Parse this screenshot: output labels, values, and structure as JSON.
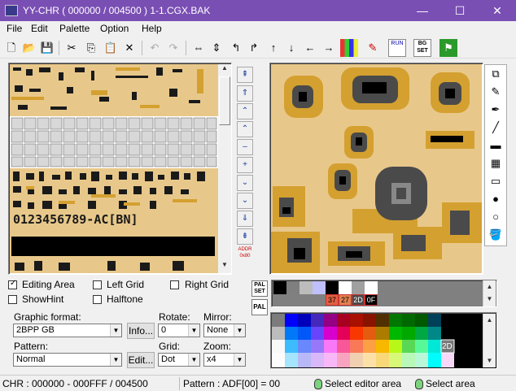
{
  "window": {
    "title": "YY-CHR ( 000000 / 004500 ) 1-1.CGX.BAK",
    "minimize": "—",
    "maximize": "☐",
    "close": "✕"
  },
  "menu": [
    "File",
    "Edit",
    "Palette",
    "Option",
    "Help"
  ],
  "toolbar": {
    "icons": [
      "new-file-icon",
      "open-folder-icon",
      "save-icon",
      "cut-icon",
      "copy-icon",
      "paste-icon",
      "delete-icon",
      "undo-icon",
      "redo-icon",
      "flip-horizontal-icon",
      "flip-vertical-icon",
      "rotate-left-icon",
      "rotate-right-icon",
      "shift-up-icon",
      "shift-down-icon",
      "shift-left-icon",
      "shift-right-icon",
      "palette-icon",
      "edit-icon",
      "run-icon",
      "bg-set-icon",
      "exit-icon"
    ],
    "run_label": "RUN",
    "bgset_label": "BG SET"
  },
  "nav": {
    "buttons": [
      "⇞",
      "⇑",
      "⌃",
      "⌃",
      "–",
      "+",
      "⌄",
      "⌄",
      "⇓",
      "⇟"
    ],
    "addr_label": "ADDR",
    "addr_value": "0x80"
  },
  "options": {
    "editing_area": "Editing Area",
    "left_grid": "Left Grid",
    "right_grid": "Right Grid",
    "show_hint": "ShowHint",
    "halftone": "Halftone"
  },
  "graphic_format": {
    "label": "Graphic format:",
    "value": "2BPP GB",
    "info_button": "Info..."
  },
  "rotate": {
    "label": "Rotate:",
    "value": "0"
  },
  "mirror": {
    "label": "Mirror:",
    "value": "None"
  },
  "pattern": {
    "label": "Pattern:",
    "value": "Normal",
    "edit_button": "Edit..."
  },
  "grid": {
    "label": "Grid:",
    "value": "Dot"
  },
  "zoom": {
    "label": "Zoom:",
    "value": "x4"
  },
  "palette": {
    "pal_set_label": "PAL SET",
    "pal_label": "PAL",
    "current_colors": [
      "#000000",
      "#7f7f7f",
      "#bcbcbc",
      "#c0c0ff",
      "#000000",
      "#ffffff",
      "#a0a0a0",
      "#ffffff"
    ],
    "tags": [
      "37",
      "27",
      "2D",
      "0F"
    ],
    "selected_tag": "2D"
  },
  "status": {
    "chr": "CHR : 000000 - 000FFF / 004500",
    "pattern": "Pattern : ADF[00] = 00",
    "select_editor": "Select editor area",
    "select_area": "Select area"
  }
}
